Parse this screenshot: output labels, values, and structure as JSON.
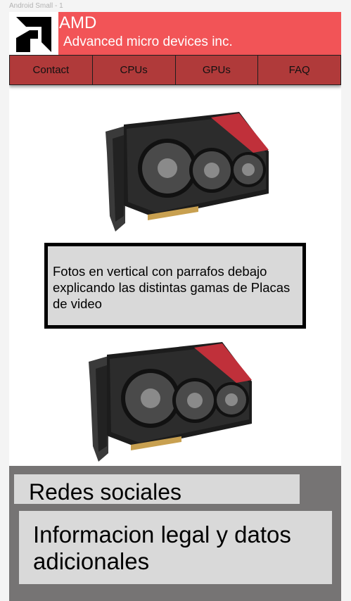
{
  "frame": {
    "label": "Android Small - 1"
  },
  "header": {
    "logo_icon": "amd-logo-icon",
    "title": "AMD",
    "subtitle": "Advanced micro devices inc."
  },
  "nav": {
    "items": [
      {
        "label": "Contact"
      },
      {
        "label": "CPUs"
      },
      {
        "label": "GPUs"
      },
      {
        "label": "FAQ"
      }
    ]
  },
  "main": {
    "images": [
      {
        "icon": "graphics-card-image"
      },
      {
        "icon": "graphics-card-image"
      }
    ],
    "caption": "Fotos en vertical con parrafos debajo explicando las distintas gamas de Placas de video"
  },
  "footer": {
    "social": "Redes sociales",
    "legal": "Informacion legal y datos adicionales"
  },
  "colors": {
    "header": "#f25457",
    "nav": "#b03a3a",
    "footer": "#767474",
    "panel": "#d9d9d9"
  }
}
